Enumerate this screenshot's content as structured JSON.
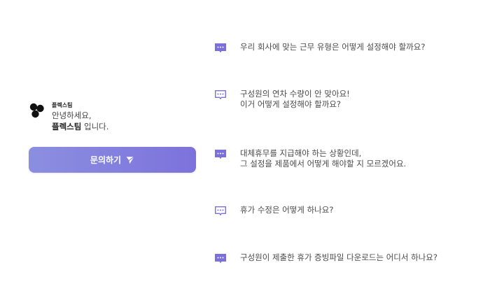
{
  "profile": {
    "team_name": "플렉스팀",
    "greeting_line1": "안녕하세요,",
    "greeting_name": "플렉스팀",
    "greeting_suffix": " 입니다."
  },
  "inquiry_button": {
    "label": "문의하기",
    "icon": "send-icon"
  },
  "colors": {
    "accent": "#7b6fd9",
    "button_gradient_start": "#8b8fe0",
    "button_gradient_end": "#7d72dc"
  },
  "faq": [
    {
      "text": "우리 회사에 맞는 근무 유형은 어떻게 설정해야 할까요?",
      "icon": "chat-filled-icon"
    },
    {
      "text": "구성원의 연차 수량이 안 맞아요!\n이거 어떻게 설정해야 할까요?",
      "icon": "chat-outline-icon"
    },
    {
      "text": "대체휴무를 지급해야 하는 상황인데,\n그 설정을 제품에서 어떻게 해야할 지 모르겠어요.",
      "icon": "chat-filled-icon"
    },
    {
      "text": "휴가 수정은 어떻게 하나요?",
      "icon": "chat-outline-icon"
    },
    {
      "text": "구성원이 제출한 휴가 증빙파일 다운로드는 어디서 하나요?",
      "icon": "chat-filled-icon"
    }
  ]
}
